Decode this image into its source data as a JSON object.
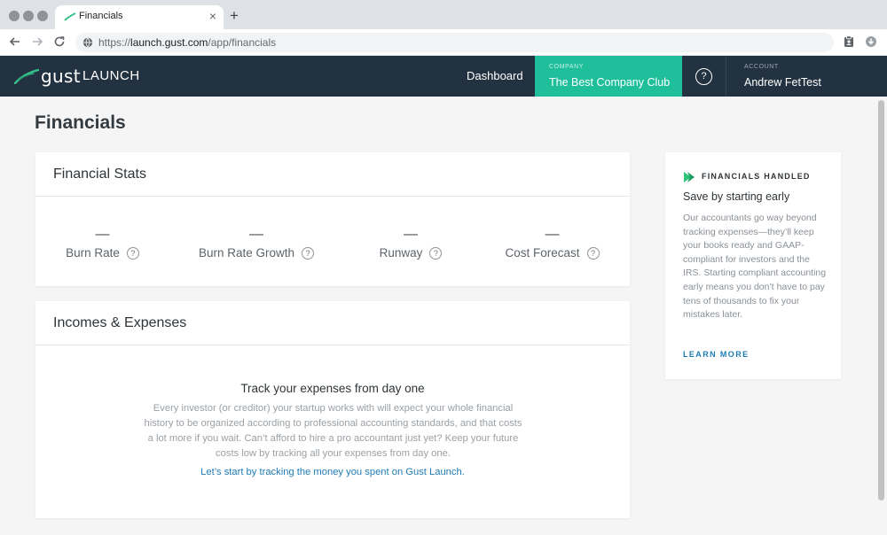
{
  "browser": {
    "tab_title": "Financials",
    "tab_close": "×",
    "new_tab": "+",
    "url_scheme": "https://",
    "url_host": "launch.gust.com",
    "url_path": "/app/financials"
  },
  "header": {
    "logo_gust": "gust",
    "logo_launch": "LAUNCH",
    "nav_dashboard": "Dashboard",
    "company_label": "COMPANY",
    "company_name": "The Best Company Club",
    "help_icon": "?",
    "account_label": "ACCOUNT",
    "account_name": "Andrew FetTest"
  },
  "page": {
    "title": "Financials"
  },
  "stats_card": {
    "title": "Financial Stats",
    "stats": [
      {
        "label": "Burn Rate",
        "value": "—"
      },
      {
        "label": "Burn Rate Growth",
        "value": "—"
      },
      {
        "label": "Runway",
        "value": "—"
      },
      {
        "label": "Cost Forecast",
        "value": "—"
      }
    ],
    "help": "?"
  },
  "incomes_card": {
    "title": "Incomes & Expenses",
    "empty_title": "Track your expenses from day one",
    "empty_body": "Every investor (or creditor) your startup works with will expect your whole financial history to be organized according to professional accounting standards, and that costs a lot more if you wait. Can’t afford to hire a pro accountant just yet? Keep your future costs low by tracking all your expenses from day one.",
    "cta": "Let’s start by tracking the money you spent on Gust Launch."
  },
  "sidebar_card": {
    "label": "FINANCIALS HANDLED",
    "title": "Save by starting early",
    "body": "Our accountants go way beyond tracking expenses—they’ll keep your books ready and GAAP-compliant for investors and the IRS. Starting compliant accounting early means you don’t have to pay tens of thousands to fix your mistakes later.",
    "link": "LEARN MORE"
  },
  "colors": {
    "header_bg": "#233240",
    "accent_green": "#1fbf9c",
    "link_blue": "#1f7bb6",
    "page_bg": "#f5f5f5"
  }
}
